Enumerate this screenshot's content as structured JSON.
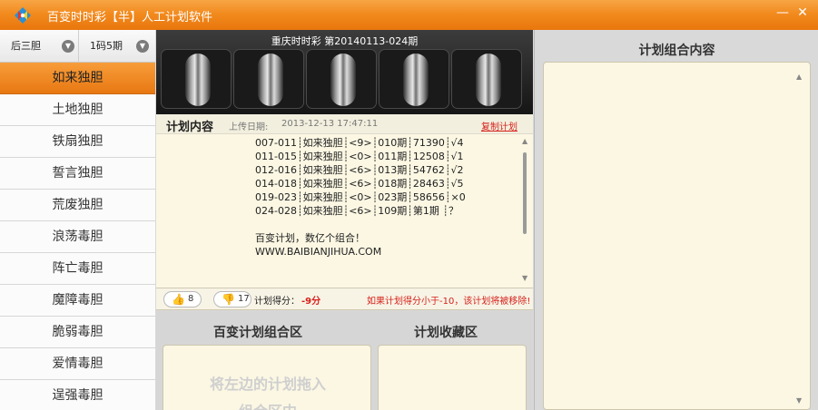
{
  "window": {
    "title": "百变时时彩【半】人工计划软件",
    "minimize_glyph": "—",
    "close_glyph": "✕",
    "accent_color": "#f28b1f"
  },
  "sidebar": {
    "filters": [
      {
        "value": "后三胆"
      },
      {
        "value": "1码5期"
      }
    ],
    "items": [
      {
        "label": "如来独胆",
        "active": true
      },
      {
        "label": "土地独胆"
      },
      {
        "label": "铁扇独胆"
      },
      {
        "label": "誓言独胆"
      },
      {
        "label": "荒废独胆"
      },
      {
        "label": "浪荡毒胆"
      },
      {
        "label": "阵亡毒胆"
      },
      {
        "label": "魔障毒胆"
      },
      {
        "label": "脆弱毒胆"
      },
      {
        "label": "爱情毒胆"
      },
      {
        "label": "逞强毒胆"
      }
    ]
  },
  "lottery": {
    "title": "重庆时时彩 第20140113-024期"
  },
  "plan": {
    "heading": "计划内容",
    "upload_label": "上传日期:",
    "upload_time": "2013-12-13 17:47:11",
    "copy_link": "复制计划",
    "lines": [
      "007-011┊如来独胆┊<9>┊010期┊71390┊√4",
      "011-015┊如来独胆┊<0>┊011期┊12508┊√1",
      "012-016┊如来独胆┊<6>┊013期┊54762┊√2",
      "014-018┊如来独胆┊<6>┊018期┊28463┊√5",
      "019-023┊如来独胆┊<0>┊023期┊58656┊×0",
      "024-028┊如来独胆┊<6>┊109期┊第1期 ┊？"
    ],
    "note_lines": [
      "百变计划，数亿个组合！",
      "WWW.BAIBIANJIHUA.COM"
    ]
  },
  "vote": {
    "up_count": "8",
    "down_count": "17",
    "score_label": "计划得分：",
    "score_value": "-9分",
    "warning": "如果计划得分小于-10，该计划将被移除!"
  },
  "combo": {
    "title": "百变计划组合区",
    "hint_line1": "将左边的计划拖入",
    "hint_line2": "组合区内"
  },
  "favorites": {
    "title": "计划收藏区"
  },
  "right_panel": {
    "title": "计划组合内容"
  }
}
